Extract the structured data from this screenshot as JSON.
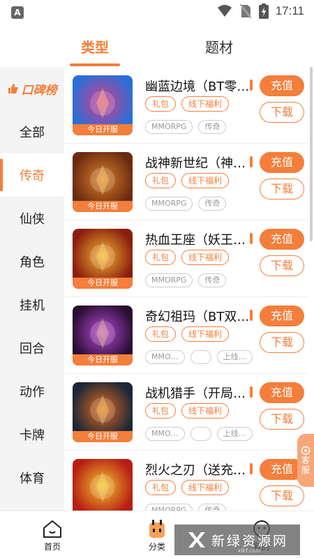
{
  "status_bar": {
    "time": "17:11",
    "app_icon_letter": "A"
  },
  "top_tabs": [
    {
      "label": "类型",
      "active": true
    },
    {
      "label": "题材",
      "active": false
    }
  ],
  "sidebar": {
    "title": "口碑榜",
    "items": [
      {
        "label": "全部",
        "active": false
      },
      {
        "label": "传奇",
        "active": true
      },
      {
        "label": "仙侠",
        "active": false
      },
      {
        "label": "角色",
        "active": false
      },
      {
        "label": "挂机",
        "active": false
      },
      {
        "label": "回合",
        "active": false
      },
      {
        "label": "动作",
        "active": false
      },
      {
        "label": "卡牌",
        "active": false
      },
      {
        "label": "体育",
        "active": false
      }
    ]
  },
  "games": [
    {
      "name": "幽蓝边境（BT零…",
      "banner": "今日开服",
      "tags": [
        "礼包",
        "线下福利"
      ],
      "categories": [
        "MMORPG",
        "传奇"
      ],
      "charge_label": "充值",
      "download_label": "下载",
      "thumb_colors": [
        "#2b6fd6",
        "#d63a8b"
      ]
    },
    {
      "name": "战神新世纪（神…",
      "banner": "今日开服",
      "tags": [
        "礼包",
        "线下福利"
      ],
      "categories": [
        "MMORPG",
        "传奇"
      ],
      "charge_label": "充值",
      "download_label": "下载",
      "thumb_colors": [
        "#6b2a10",
        "#d9822b"
      ]
    },
    {
      "name": "热血王座（妖王…",
      "banner": "今日开服",
      "tags": [
        "礼包",
        "线下福利"
      ],
      "categories": [
        "MMORPG",
        "传奇"
      ],
      "charge_label": "充值",
      "download_label": "下载",
      "thumb_colors": [
        "#8a1e0e",
        "#f2b233"
      ]
    },
    {
      "name": "奇幻祖玛（BT双…",
      "banner": "今日开服",
      "tags": [
        "礼包",
        "线下福利"
      ],
      "categories": [
        "MMO…",
        "",
        "上线…"
      ],
      "charge_label": "充值",
      "download_label": "下载",
      "thumb_colors": [
        "#2a0e32",
        "#b54ad6"
      ]
    },
    {
      "name": "战机猎手（开局…",
      "banner": "今日开服",
      "tags": [
        "礼包",
        "线下福利"
      ],
      "categories": [
        "MMO…",
        "",
        "上线…"
      ],
      "charge_label": "充值",
      "download_label": "下载",
      "thumb_colors": [
        "#1c2738",
        "#e06a1e"
      ]
    },
    {
      "name": "烈火之刃（送充…",
      "banner": "",
      "tags": [
        "礼包",
        "线下福利"
      ],
      "categories": [
        "MMORPG",
        "传奇"
      ],
      "charge_label": "充值",
      "download_label": "下载",
      "thumb_colors": [
        "#b81e14",
        "#f0c22e"
      ]
    }
  ],
  "float_service": {
    "label_top": "客",
    "label_bottom": "服"
  },
  "bottom_nav": [
    {
      "label": "首页",
      "icon": "home-icon"
    },
    {
      "label": "分类",
      "icon": "category-icon"
    },
    {
      "label": "我的",
      "icon": "profile-icon"
    }
  ],
  "watermark": {
    "text": "新绿资源网",
    "sub": "xlkf.com"
  },
  "colors": {
    "accent": "#f47e3b",
    "sidebar_bg": "#f4f4f4"
  }
}
